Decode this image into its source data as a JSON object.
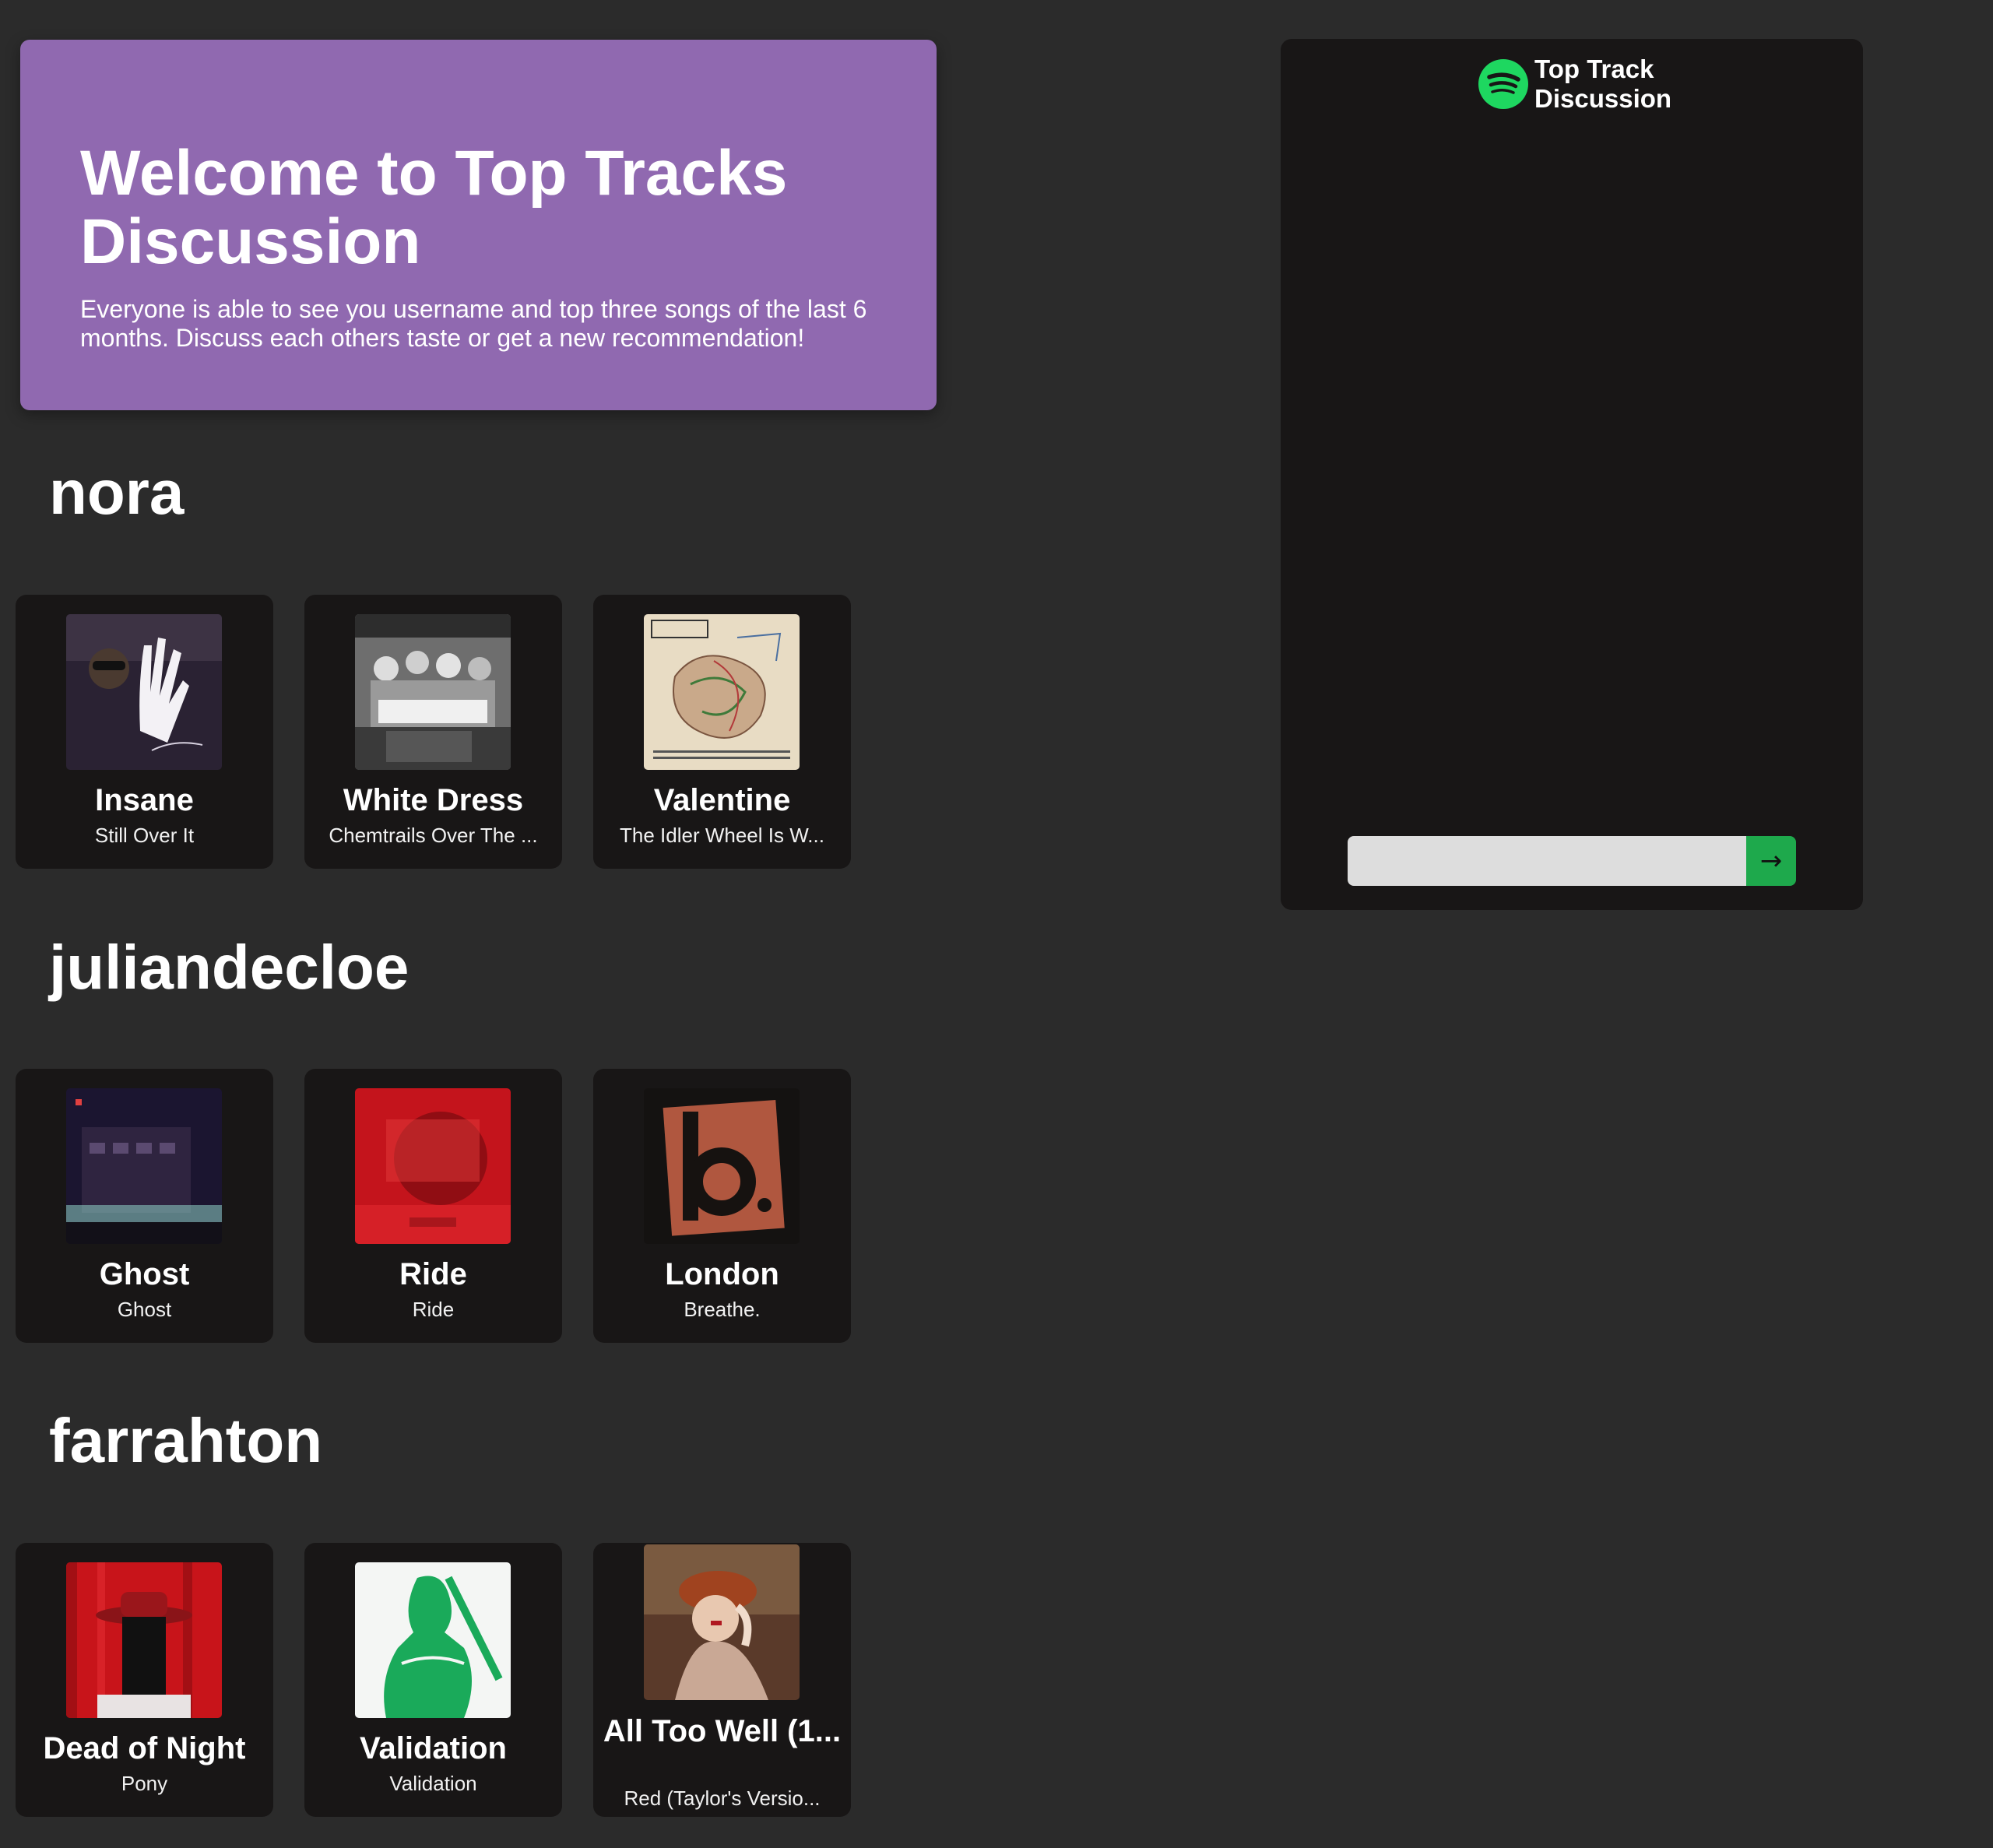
{
  "hero": {
    "title": "Welcome to Top Tracks Discussion",
    "description": "Everyone is able to see you username and top three songs of the last 6 months. Discuss each others taste or get a new recommendation!"
  },
  "users": [
    {
      "name": "nora",
      "tracks": [
        {
          "title": "Insane",
          "album": "Still Over It"
        },
        {
          "title": "White Dress",
          "album": "Chemtrails Over The ..."
        },
        {
          "title": "Valentine",
          "album": "The Idler Wheel Is W..."
        }
      ]
    },
    {
      "name": "juliandecloe",
      "tracks": [
        {
          "title": "Ghost",
          "album": "Ghost"
        },
        {
          "title": "Ride",
          "album": "Ride"
        },
        {
          "title": "London",
          "album": "Breathe."
        }
      ]
    },
    {
      "name": "farrahton",
      "tracks": [
        {
          "title": "Dead of Night",
          "album": "Pony"
        },
        {
          "title": "Validation",
          "album": "Validation"
        },
        {
          "title": "All Too Well (1...",
          "album": "Red (Taylor's Versio..."
        }
      ]
    }
  ],
  "chat": {
    "title": "Top Track Discussion",
    "logo_icon": "spotify-logo-icon",
    "input_value": "",
    "send_icon": "arrow-right-icon",
    "send_symbol": "→"
  },
  "colors": {
    "page_bg": "#2b2b2b",
    "hero_bg": "#9069b0",
    "card_bg": "#181616",
    "spotify_green": "#1ed760",
    "send_button": "#1ea94c"
  }
}
